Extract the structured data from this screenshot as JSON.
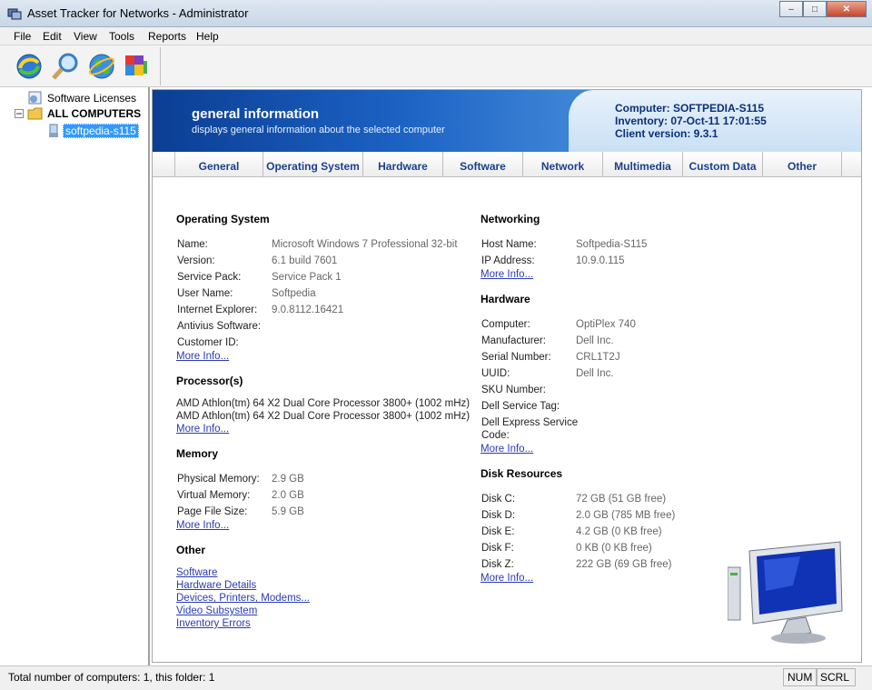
{
  "window": {
    "title": "Asset Tracker for Networks - Administrator",
    "min": "–",
    "max": "□",
    "close": "✕"
  },
  "menu": [
    "File",
    "Edit",
    "View",
    "Tools",
    "Reports",
    "Help"
  ],
  "toolbar": [
    "refresh-icon",
    "search-icon",
    "globe-icon",
    "package-icon"
  ],
  "tree": {
    "software_licenses": "Software Licenses",
    "all_computers": "ALL COMPUTERS",
    "selected": "softpedia-s115"
  },
  "banner": {
    "title": "general information",
    "subtitle": "displays general information about the selected computer",
    "computer": "Computer: SOFTPEDIA-S115",
    "inventory": "Inventory: 07-Oct-11 17:01:55",
    "client": "Client version: 9.3.1"
  },
  "tabs": [
    "General",
    "Operating System",
    "Hardware",
    "Software",
    "Network",
    "Multimedia",
    "Custom Data",
    "Other"
  ],
  "os": {
    "heading": "Operating System",
    "rows": [
      {
        "label": "Name:",
        "value": "Microsoft Windows 7 Professional 32-bit"
      },
      {
        "label": "Version:",
        "value": "6.1 build 7601"
      },
      {
        "label": "Service Pack:",
        "value": "Service Pack 1"
      },
      {
        "label": "User Name:",
        "value": "Softpedia"
      },
      {
        "label": "Internet Explorer:",
        "value": "9.0.8112.16421"
      },
      {
        "label": "Antivius Software:",
        "value": ""
      },
      {
        "label": "Customer ID:",
        "value": ""
      }
    ],
    "more": "More Info..."
  },
  "processor": {
    "heading": "Processor(s)",
    "lines": [
      "AMD Athlon(tm) 64 X2 Dual Core Processor 3800+ (1002 mHz)",
      "AMD Athlon(tm) 64 X2 Dual Core Processor 3800+ (1002 mHz)"
    ],
    "more": "More Info..."
  },
  "memory": {
    "heading": "Memory",
    "rows": [
      {
        "label": "Physical Memory:",
        "value": "2.9 GB"
      },
      {
        "label": "Virtual Memory:",
        "value": "2.0 GB"
      },
      {
        "label": "Page File Size:",
        "value": "5.9 GB"
      }
    ],
    "more": "More Info..."
  },
  "other": {
    "heading": "Other",
    "links": [
      "Software",
      "Hardware Details",
      "Devices, Printers, Modems...",
      "Video Subsystem",
      "Inventory Errors"
    ]
  },
  "networking": {
    "heading": "Networking",
    "rows": [
      {
        "label": "Host Name:",
        "value": "Softpedia-S115"
      },
      {
        "label": "IP Address:",
        "value": "10.9.0.115"
      }
    ],
    "more": "More Info..."
  },
  "hardware": {
    "heading": "Hardware",
    "rows": [
      {
        "label": "Computer:",
        "value": "OptiPlex 740"
      },
      {
        "label": "Manufacturer:",
        "value": "Dell Inc."
      },
      {
        "label": "Serial Number:",
        "value": "CRL1T2J"
      },
      {
        "label": "UUID:",
        "value": "Dell Inc."
      },
      {
        "label": "SKU Number:",
        "value": ""
      },
      {
        "label": "Dell Service Tag:",
        "value": ""
      },
      {
        "label": "Dell Express Service",
        "value": ""
      },
      {
        "label": "Code:",
        "value": ""
      }
    ],
    "more": "More Info..."
  },
  "disks": {
    "heading": "Disk Resources",
    "rows": [
      {
        "label": "Disk C:",
        "value": "72 GB (51 GB free)"
      },
      {
        "label": "Disk D:",
        "value": "2.0 GB (785 MB free)"
      },
      {
        "label": "Disk E:",
        "value": "4.2 GB (0 KB free)"
      },
      {
        "label": "Disk F:",
        "value": "0 KB (0 KB free)"
      },
      {
        "label": "Disk Z:",
        "value": "222 GB (69 GB free)"
      }
    ],
    "more": "More Info..."
  },
  "status": {
    "text": "Total number of computers: 1, this folder: 1",
    "num": "NUM",
    "scrl": "SCRL"
  }
}
